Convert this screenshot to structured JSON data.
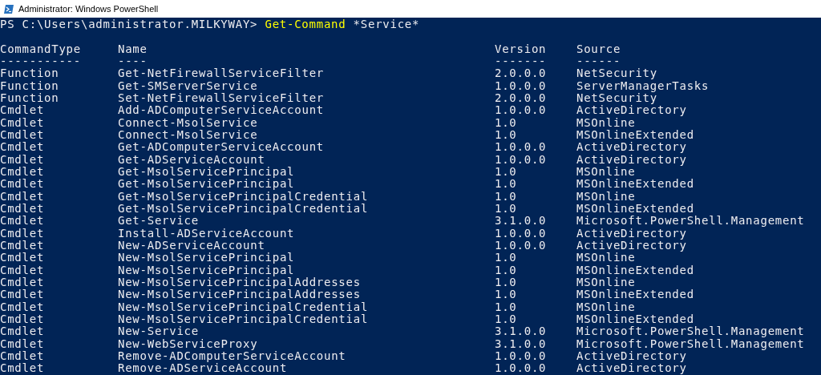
{
  "window": {
    "title": "Administrator: Windows PowerShell"
  },
  "prompt": {
    "path": "PS C:\\Users\\administrator.MILKYWAY>",
    "command": "Get-Command",
    "argument": "*Service*"
  },
  "columns": [
    {
      "header": "CommandType",
      "underline": "-----------"
    },
    {
      "header": "Name",
      "underline": "----"
    },
    {
      "header": "Version",
      "underline": "-------"
    },
    {
      "header": "Source",
      "underline": "------"
    }
  ],
  "rows": [
    {
      "command_type": "Function",
      "name": "Get-NetFirewallServiceFilter",
      "version": "2.0.0.0",
      "source": "NetSecurity"
    },
    {
      "command_type": "Function",
      "name": "Get-SMServerService",
      "version": "1.0.0.0",
      "source": "ServerManagerTasks"
    },
    {
      "command_type": "Function",
      "name": "Set-NetFirewallServiceFilter",
      "version": "2.0.0.0",
      "source": "NetSecurity"
    },
    {
      "command_type": "Cmdlet",
      "name": "Add-ADComputerServiceAccount",
      "version": "1.0.0.0",
      "source": "ActiveDirectory"
    },
    {
      "command_type": "Cmdlet",
      "name": "Connect-MsolService",
      "version": "1.0",
      "source": "MSOnline"
    },
    {
      "command_type": "Cmdlet",
      "name": "Connect-MsolService",
      "version": "1.0",
      "source": "MSOnlineExtended"
    },
    {
      "command_type": "Cmdlet",
      "name": "Get-ADComputerServiceAccount",
      "version": "1.0.0.0",
      "source": "ActiveDirectory"
    },
    {
      "command_type": "Cmdlet",
      "name": "Get-ADServiceAccount",
      "version": "1.0.0.0",
      "source": "ActiveDirectory"
    },
    {
      "command_type": "Cmdlet",
      "name": "Get-MsolServicePrincipal",
      "version": "1.0",
      "source": "MSOnline"
    },
    {
      "command_type": "Cmdlet",
      "name": "Get-MsolServicePrincipal",
      "version": "1.0",
      "source": "MSOnlineExtended"
    },
    {
      "command_type": "Cmdlet",
      "name": "Get-MsolServicePrincipalCredential",
      "version": "1.0",
      "source": "MSOnline"
    },
    {
      "command_type": "Cmdlet",
      "name": "Get-MsolServicePrincipalCredential",
      "version": "1.0",
      "source": "MSOnlineExtended"
    },
    {
      "command_type": "Cmdlet",
      "name": "Get-Service",
      "version": "3.1.0.0",
      "source": "Microsoft.PowerShell.Management"
    },
    {
      "command_type": "Cmdlet",
      "name": "Install-ADServiceAccount",
      "version": "1.0.0.0",
      "source": "ActiveDirectory"
    },
    {
      "command_type": "Cmdlet",
      "name": "New-ADServiceAccount",
      "version": "1.0.0.0",
      "source": "ActiveDirectory"
    },
    {
      "command_type": "Cmdlet",
      "name": "New-MsolServicePrincipal",
      "version": "1.0",
      "source": "MSOnline"
    },
    {
      "command_type": "Cmdlet",
      "name": "New-MsolServicePrincipal",
      "version": "1.0",
      "source": "MSOnlineExtended"
    },
    {
      "command_type": "Cmdlet",
      "name": "New-MsolServicePrincipalAddresses",
      "version": "1.0",
      "source": "MSOnline"
    },
    {
      "command_type": "Cmdlet",
      "name": "New-MsolServicePrincipalAddresses",
      "version": "1.0",
      "source": "MSOnlineExtended"
    },
    {
      "command_type": "Cmdlet",
      "name": "New-MsolServicePrincipalCredential",
      "version": "1.0",
      "source": "MSOnline"
    },
    {
      "command_type": "Cmdlet",
      "name": "New-MsolServicePrincipalCredential",
      "version": "1.0",
      "source": "MSOnlineExtended"
    },
    {
      "command_type": "Cmdlet",
      "name": "New-Service",
      "version": "3.1.0.0",
      "source": "Microsoft.PowerShell.Management"
    },
    {
      "command_type": "Cmdlet",
      "name": "New-WebServiceProxy",
      "version": "3.1.0.0",
      "source": "Microsoft.PowerShell.Management"
    },
    {
      "command_type": "Cmdlet",
      "name": "Remove-ADComputerServiceAccount",
      "version": "1.0.0.0",
      "source": "ActiveDirectory"
    },
    {
      "command_type": "Cmdlet",
      "name": "Remove-ADServiceAccount",
      "version": "1.0.0.0",
      "source": "ActiveDirectory"
    }
  ]
}
